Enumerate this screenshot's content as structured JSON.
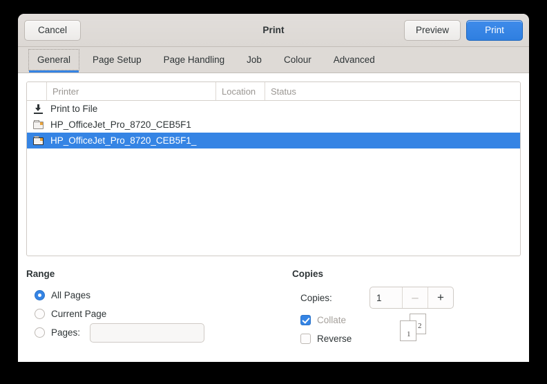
{
  "window": {
    "title": "Print"
  },
  "header": {
    "cancel_label": "Cancel",
    "preview_label": "Preview",
    "print_label": "Print"
  },
  "tabs": [
    {
      "label": "General",
      "active": true
    },
    {
      "label": "Page Setup",
      "active": false
    },
    {
      "label": "Page Handling",
      "active": false
    },
    {
      "label": "Job",
      "active": false
    },
    {
      "label": "Colour",
      "active": false
    },
    {
      "label": "Advanced",
      "active": false
    }
  ],
  "printer_list": {
    "columns": [
      "",
      "Printer",
      "Location",
      "Status"
    ],
    "rows": [
      {
        "icon": "download-icon",
        "printer": "Print to File",
        "location": "",
        "status": "",
        "selected": false
      },
      {
        "icon": "printer-icon",
        "printer": "HP_OfficeJet_Pro_8720_CEB5F1",
        "location": "",
        "status": "",
        "selected": false
      },
      {
        "icon": "printer-icon",
        "printer": "HP_OfficeJet_Pro_8720_CEB5F1_",
        "location": "",
        "status": "",
        "selected": true
      }
    ]
  },
  "range": {
    "title": "Range",
    "all_pages_label": "All Pages",
    "current_page_label": "Current Page",
    "pages_label": "Pages:",
    "pages_value": "",
    "pages_placeholder": "",
    "selected": "all_pages"
  },
  "copies": {
    "title": "Copies",
    "copies_label": "Copies:",
    "copies_value": "1",
    "decrement_label": "–",
    "increment_label": "+",
    "collate_label": "Collate",
    "collate_checked": true,
    "collate_enabled": false,
    "reverse_label": "Reverse",
    "reverse_checked": false,
    "preview_page_1": "1",
    "preview_page_2": "2"
  },
  "colors": {
    "accent": "#3584e4",
    "headerbar": "#dedad6",
    "selection": "#3584e4",
    "text": "#2e3436",
    "muted": "#9a9692",
    "printer_icon_tab": "#e8a33d"
  }
}
